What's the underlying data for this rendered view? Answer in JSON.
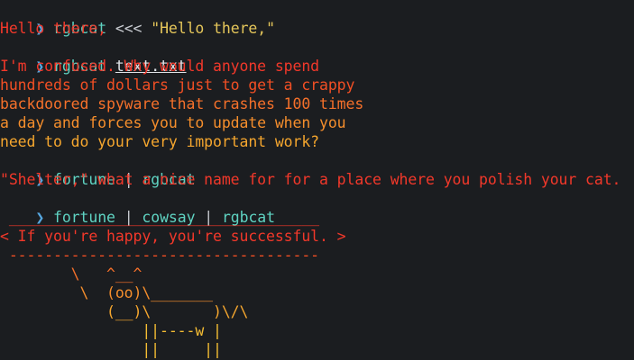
{
  "terminal": {
    "prompt_symbol": "❯",
    "commands": [
      {
        "program": "rgbcat",
        "operator": "<<<",
        "argument": "\"Hello there,\""
      },
      {
        "program": "rgbcat",
        "argument": "text.txt"
      },
      {
        "program": "fortune",
        "pipe": "|",
        "program2": "rgbcat"
      },
      {
        "program": "fortune",
        "pipe": "|",
        "program2": "cowsay",
        "pipe2": "|",
        "program3": "rgbcat"
      }
    ],
    "outputs": {
      "hello": "Hello there,",
      "text_lines": [
        "I'm confused. Why would anyone spend",
        "hundreds of dollars just to get a crappy",
        "backdoored spyware that crashes 100 times",
        "a day and forces you to update when you",
        "need to do your very important work?"
      ],
      "fortune": "\"Shelter,\" what a nice name for for a place where you polish your cat.",
      "cowsay_lines": [
        " ___________________________________",
        "< If you're happy, you're successful. >",
        " -----------------------------------",
        "        \\   ^__^",
        "         \\  (oo)\\_______",
        "            (__)\\       )\\/\\",
        "                ||----w |",
        "                ||     ||"
      ]
    },
    "colors": {
      "background": "#1b1d20",
      "prompt": "#56a7e0",
      "command": "#5fd3c2",
      "string": "#e5c65a",
      "rainbow": [
        "#f2382a",
        "#f24f24",
        "#f5702a",
        "#f58e2c",
        "#f5a62e",
        "#f5bd33"
      ]
    }
  }
}
